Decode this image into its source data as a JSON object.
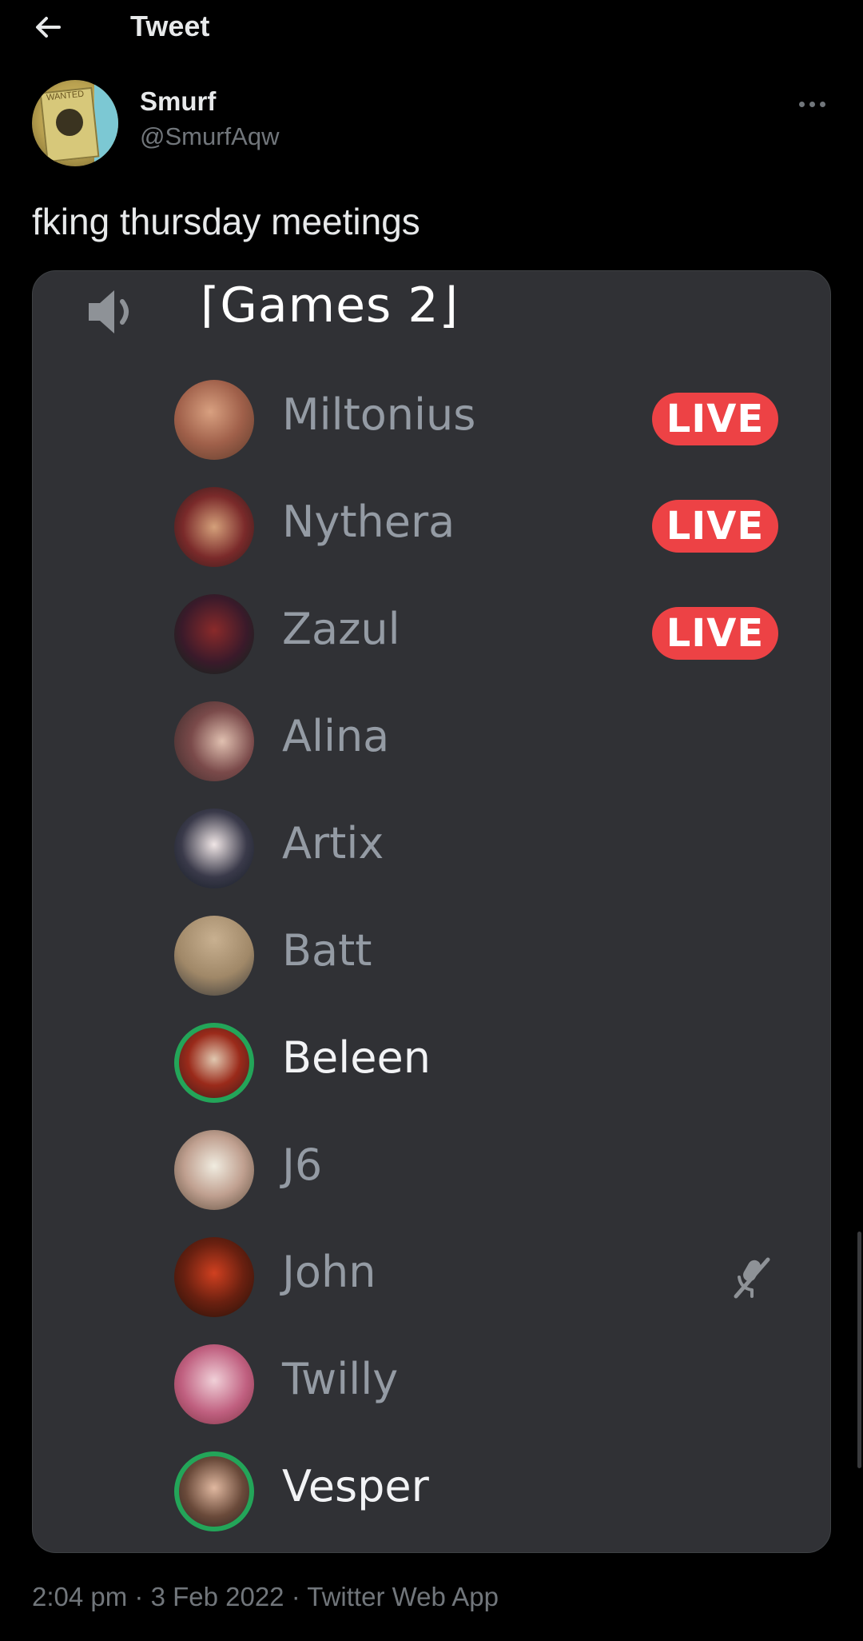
{
  "header": {
    "title": "Tweet"
  },
  "tweet": {
    "author_name": "Smurf",
    "author_handle": "@SmurfAqw",
    "text": "fking thursday meetings",
    "timestamp": "2:04 pm · 3 Feb 2022 · Twitter Web App",
    "avatar_text": "WANTED"
  },
  "voice_channel": {
    "name": "⌈Games 2⌋",
    "live_label": "LIVE",
    "members": [
      {
        "name": "Miltonius",
        "live": true,
        "speaking": false,
        "muted": false
      },
      {
        "name": "Nythera",
        "live": true,
        "speaking": false,
        "muted": false
      },
      {
        "name": "Zazul",
        "live": true,
        "speaking": false,
        "muted": false
      },
      {
        "name": "Alina",
        "live": false,
        "speaking": false,
        "muted": false
      },
      {
        "name": "Artix",
        "live": false,
        "speaking": false,
        "muted": false
      },
      {
        "name": "Batt",
        "live": false,
        "speaking": false,
        "muted": false
      },
      {
        "name": "Beleen",
        "live": false,
        "speaking": true,
        "muted": false
      },
      {
        "name": "J6",
        "live": false,
        "speaking": false,
        "muted": false
      },
      {
        "name": "John",
        "live": false,
        "speaking": false,
        "muted": true
      },
      {
        "name": "Twilly",
        "live": false,
        "speaking": false,
        "muted": false
      },
      {
        "name": "Vesper",
        "live": false,
        "speaking": true,
        "muted": false
      }
    ]
  },
  "colors": {
    "background": "#000000",
    "discord_panel": "#303135",
    "live_red": "#ed4245",
    "speaking_green": "#23a559",
    "muted_text": "#71767b"
  }
}
